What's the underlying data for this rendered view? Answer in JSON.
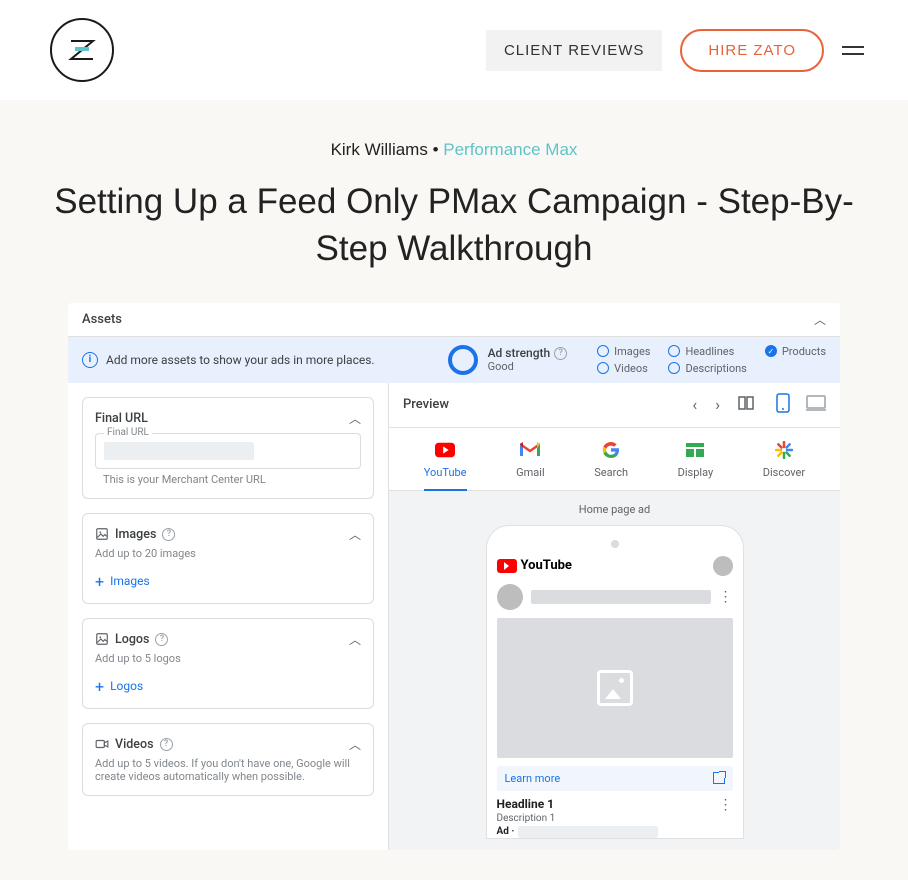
{
  "header": {
    "reviews_label": "CLIENT REVIEWS",
    "hire_label": "HIRE ZATO"
  },
  "article": {
    "author": "Kirk Williams",
    "separator": " • ",
    "category": "Performance Max",
    "title": "Setting Up a Feed Only PMax Campaign - Step-By-Step Walkthrough"
  },
  "assets_bar": {
    "label": "Assets"
  },
  "info": {
    "text": "Add more assets to show your ads in more places.",
    "strength_label": "Ad strength",
    "strength_value": "Good",
    "checks": {
      "images": "Images",
      "videos": "Videos",
      "headlines": "Headlines",
      "descriptions": "Descriptions",
      "products": "Products"
    }
  },
  "left": {
    "final_url": {
      "title": "Final URL",
      "field_label": "Final URL",
      "helper": "This is your Merchant Center URL"
    },
    "images": {
      "title": "Images",
      "sub": "Add up to 20 images",
      "link": "Images"
    },
    "logos": {
      "title": "Logos",
      "sub": "Add up to 5 logos",
      "link": "Logos"
    },
    "videos": {
      "title": "Videos",
      "sub": "Add up to 5 videos. If you don't have one, Google will create videos automatically when possible."
    }
  },
  "preview": {
    "label": "Preview",
    "tabs": {
      "youtube": "YouTube",
      "gmail": "Gmail",
      "search": "Search",
      "display": "Display",
      "discover": "Discover"
    },
    "home_label": "Home page ad",
    "youtube_brand": "YouTube",
    "learn_more": "Learn more",
    "headline": "Headline 1",
    "description": "Description 1",
    "ad_label": "Ad ·"
  }
}
